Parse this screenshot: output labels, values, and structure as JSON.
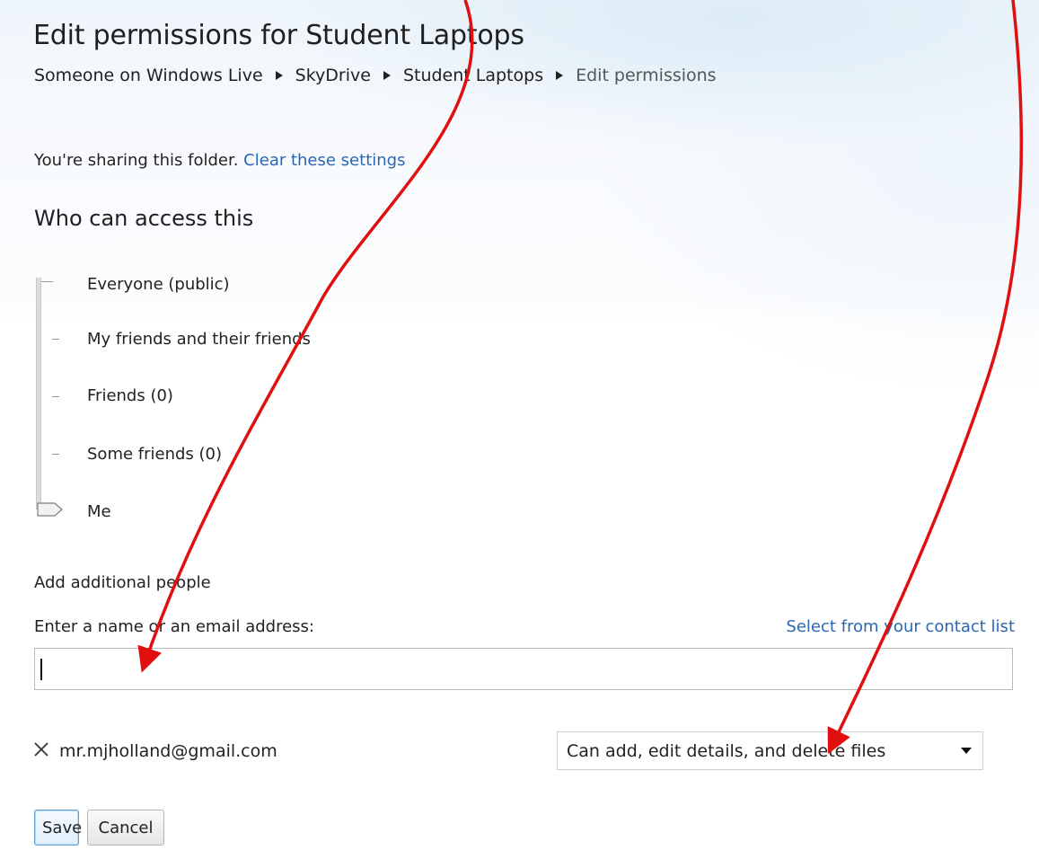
{
  "header": {
    "title": "Edit permissions for Student Laptops",
    "breadcrumb": [
      "Someone on Windows Live",
      "SkyDrive",
      "Student Laptops",
      "Edit permissions"
    ]
  },
  "sharing": {
    "text": "You're sharing this folder.",
    "clear_link": "Clear these settings"
  },
  "access": {
    "heading": "Who can access this",
    "levels": [
      "Everyone (public)",
      "My friends and their friends",
      "Friends (0)",
      "Some friends (0)",
      "Me"
    ],
    "selected_level": "Me"
  },
  "add_people": {
    "heading": "Add additional people",
    "field_label": "Enter a name or an email address:",
    "contact_link": "Select from your contact list",
    "input_value": ""
  },
  "people": [
    {
      "email": "mr.mjholland@gmail.com",
      "permission": "Can add, edit details, and delete files"
    }
  ],
  "buttons": {
    "save": "Save",
    "cancel": "Cancel"
  },
  "annotation": {
    "arrow_color": "#e01010"
  }
}
